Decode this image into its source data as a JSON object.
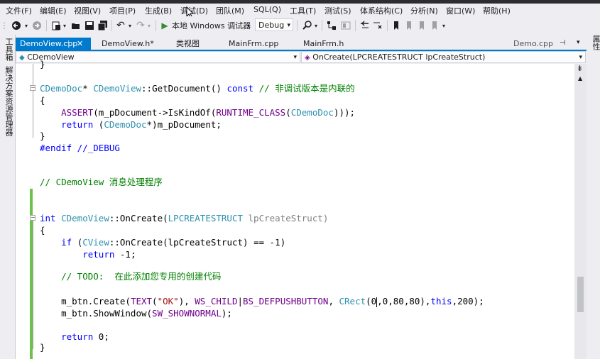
{
  "menu": [
    "文件(F)",
    "编辑(E)",
    "视图(V)",
    "项目(P)",
    "生成(B)",
    "调试(D)",
    "团队(M)",
    "SQL(Q)",
    "工具(T)",
    "测试(S)",
    "体系结构(C)",
    "分析(N)",
    "窗口(W)",
    "帮助(H)"
  ],
  "toolbar": {
    "run_label": "本地 Windows 调试器",
    "config_value": "Debug"
  },
  "left_panel": {
    "toolbox_label": "工具箱",
    "solution_explorer_label": "解决方案资源管理器"
  },
  "right_panel": {
    "properties_label": "属性"
  },
  "tabs": [
    {
      "label": "DemoView.cpp",
      "active": true
    },
    {
      "label": "DemoView.h*",
      "active": false
    },
    {
      "label": "类视图",
      "active": false
    },
    {
      "label": "MainFrm.cpp",
      "active": false
    },
    {
      "label": "MainFrm.h",
      "active": false
    },
    {
      "label": "Demo.cpp",
      "active": false
    }
  ],
  "navbar": {
    "class_combo": "CDemoView",
    "member_combo": "OnCreate(LPCREATESTRUCT lpCreateStruct)"
  },
  "code": {
    "l0": "}",
    "l1a": "CDemoDoc",
    "l1b": "* ",
    "l1c": "CDemoView",
    "l1d": "::GetDocument() ",
    "l1e": "const",
    "l1f": " // 非调试版本是内联的",
    "l2": "{",
    "l3a": "    ",
    "l3b": "ASSERT",
    "l3c": "(m_pDocument->IsKindOf(",
    "l3d": "RUNTIME_CLASS",
    "l3e": "(",
    "l3f": "CDemoDoc",
    "l3g": ")));",
    "l4a": "    ",
    "l4b": "return",
    "l4c": " (",
    "l4d": "CDemoDoc",
    "l4e": "*)m_pDocument;",
    "l5": "}",
    "l6": "#endif //_DEBUG",
    "l7": "// CDemoView 消息处理程序",
    "l8a": "int",
    "l8b": " ",
    "l8c": "CDemoView",
    "l8d": "::OnCreate(",
    "l8e": "LPCREATESTRUCT",
    "l8f": " lpCreateStruct)",
    "l9": "{",
    "l10a": "    ",
    "l10b": "if",
    "l10c": " (",
    "l10d": "CView",
    "l10e": "::OnCreate(lpCreateStruct) == -1)",
    "l11a": "        ",
    "l11b": "return",
    "l11c": " -1;",
    "l12": "    // TODO:  在此添加您专用的创建代码",
    "l13a": "    m_btn.Create(",
    "l13b": "TEXT",
    "l13c": "(",
    "l13d": "\"OK\"",
    "l13e": "), ",
    "l13f": "WS_CHILD",
    "l13g": "|",
    "l13h": "BS_DEFPUSHBUTTON",
    "l13i": ", ",
    "l13j": "CRect",
    "l13k": "(0",
    "l13l": ",0,80,80),",
    "l13m": "this",
    "l13n": ",200);",
    "l14a": "    m_btn.ShowWindow(",
    "l14b": "SW_SHOWNORMAL",
    "l14c": ");",
    "l15a": "    ",
    "l15b": "return",
    "l15c": " 0;",
    "l16": "}"
  }
}
